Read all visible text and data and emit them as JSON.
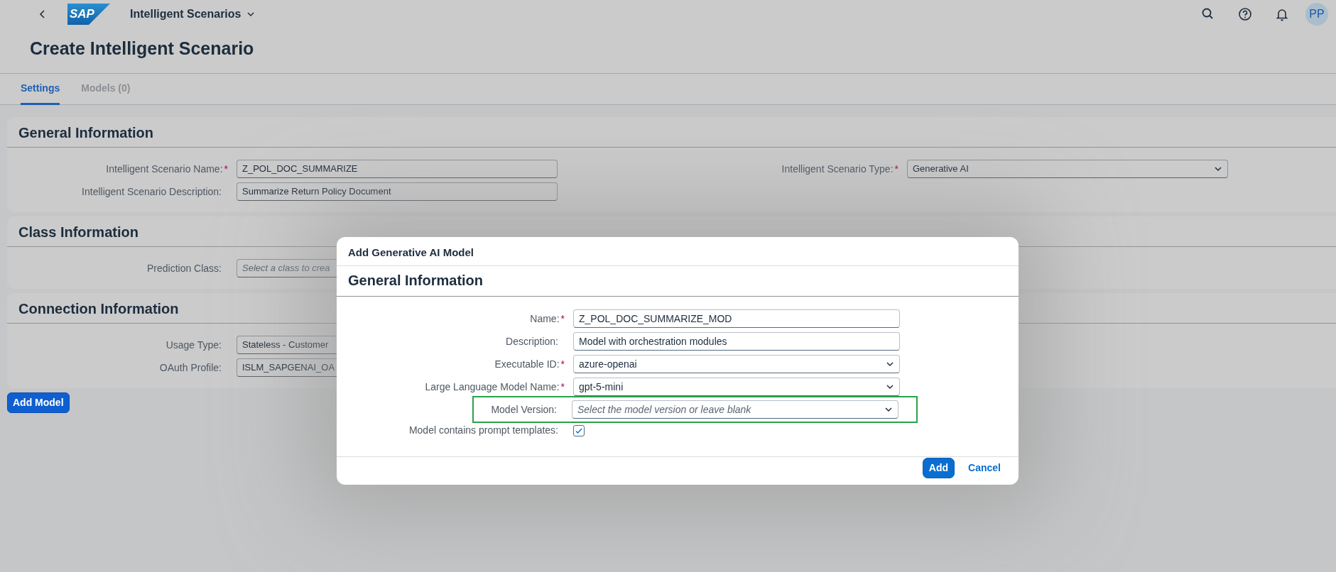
{
  "shell": {
    "logo_text": "SAP",
    "app_title": "Intelligent Scenarios",
    "avatar": "PP"
  },
  "page_title": "Create Intelligent Scenario",
  "tabs": [
    {
      "label": "Settings",
      "selected": true
    },
    {
      "label": "Models (0)",
      "selected": false
    }
  ],
  "sections": [
    {
      "title": "General Information",
      "left_fields": [
        {
          "label": "Intelligent Scenario Name:",
          "required_mark": "*",
          "kind": "input",
          "value": "Z_POL_DOC_SUMMARIZE"
        },
        {
          "label": "Intelligent Scenario Description:",
          "kind": "input",
          "value": "Summarize Return Policy Document"
        }
      ],
      "right_fields": [
        {
          "label": "Intelligent Scenario Type:",
          "required_mark": "*",
          "kind": "select",
          "value": "Generative AI"
        }
      ]
    },
    {
      "title": "Class Information",
      "left_fields": [
        {
          "label": "Prediction Class:",
          "kind": "input",
          "placeholder": "Select a class to crea"
        }
      ]
    },
    {
      "title": "Connection Information",
      "left_fields": [
        {
          "label": "Usage Type:",
          "kind": "input",
          "value": "Stateless - Customer"
        },
        {
          "label": "OAuth Profile:",
          "kind": "input",
          "value": "ISLM_SAPGENAI_OA"
        }
      ]
    }
  ],
  "add_model_button": "Add Model",
  "dialog": {
    "title": "Add Generative AI Model",
    "section_title": "General Information",
    "fields": [
      {
        "label": "Name:",
        "required_mark": "*",
        "kind": "input",
        "value": "Z_POL_DOC_SUMMARIZE_MOD",
        "highlighted": false
      },
      {
        "label": "Description:",
        "kind": "input",
        "value": "Model with orchestration modules",
        "highlighted": false
      },
      {
        "label": "Executable ID:",
        "required_mark": "*",
        "kind": "select",
        "value": "azure-openai",
        "highlighted": false
      },
      {
        "label": "Large Language Model Name:",
        "required_mark": "*",
        "kind": "select",
        "value": "gpt-5-mini",
        "highlighted": false
      },
      {
        "label": "Model Version:",
        "kind": "select",
        "placeholder": "Select the model version or leave blank",
        "highlighted": true
      },
      {
        "label": "Model contains prompt templates:",
        "kind": "checkbox",
        "checked": true,
        "highlighted": false
      }
    ],
    "buttons": [
      {
        "label": "Add",
        "kind": "primary"
      },
      {
        "label": "Cancel",
        "kind": "link"
      }
    ]
  }
}
